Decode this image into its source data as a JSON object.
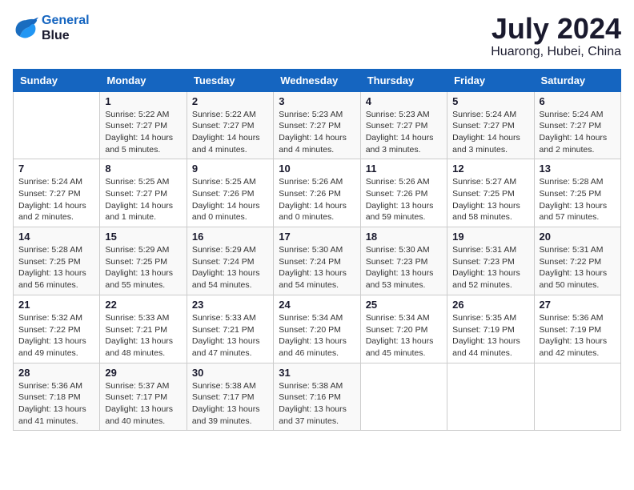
{
  "header": {
    "logo_line1": "General",
    "logo_line2": "Blue",
    "month_year": "July 2024",
    "location": "Huarong, Hubei, China"
  },
  "calendar": {
    "days_of_week": [
      "Sunday",
      "Monday",
      "Tuesday",
      "Wednesday",
      "Thursday",
      "Friday",
      "Saturday"
    ],
    "weeks": [
      [
        {
          "day": "",
          "info": ""
        },
        {
          "day": "1",
          "info": "Sunrise: 5:22 AM\nSunset: 7:27 PM\nDaylight: 14 hours\nand 5 minutes."
        },
        {
          "day": "2",
          "info": "Sunrise: 5:22 AM\nSunset: 7:27 PM\nDaylight: 14 hours\nand 4 minutes."
        },
        {
          "day": "3",
          "info": "Sunrise: 5:23 AM\nSunset: 7:27 PM\nDaylight: 14 hours\nand 4 minutes."
        },
        {
          "day": "4",
          "info": "Sunrise: 5:23 AM\nSunset: 7:27 PM\nDaylight: 14 hours\nand 3 minutes."
        },
        {
          "day": "5",
          "info": "Sunrise: 5:24 AM\nSunset: 7:27 PM\nDaylight: 14 hours\nand 3 minutes."
        },
        {
          "day": "6",
          "info": "Sunrise: 5:24 AM\nSunset: 7:27 PM\nDaylight: 14 hours\nand 2 minutes."
        }
      ],
      [
        {
          "day": "7",
          "info": "Sunrise: 5:24 AM\nSunset: 7:27 PM\nDaylight: 14 hours\nand 2 minutes."
        },
        {
          "day": "8",
          "info": "Sunrise: 5:25 AM\nSunset: 7:27 PM\nDaylight: 14 hours\nand 1 minute."
        },
        {
          "day": "9",
          "info": "Sunrise: 5:25 AM\nSunset: 7:26 PM\nDaylight: 14 hours\nand 0 minutes."
        },
        {
          "day": "10",
          "info": "Sunrise: 5:26 AM\nSunset: 7:26 PM\nDaylight: 14 hours\nand 0 minutes."
        },
        {
          "day": "11",
          "info": "Sunrise: 5:26 AM\nSunset: 7:26 PM\nDaylight: 13 hours\nand 59 minutes."
        },
        {
          "day": "12",
          "info": "Sunrise: 5:27 AM\nSunset: 7:25 PM\nDaylight: 13 hours\nand 58 minutes."
        },
        {
          "day": "13",
          "info": "Sunrise: 5:28 AM\nSunset: 7:25 PM\nDaylight: 13 hours\nand 57 minutes."
        }
      ],
      [
        {
          "day": "14",
          "info": "Sunrise: 5:28 AM\nSunset: 7:25 PM\nDaylight: 13 hours\nand 56 minutes."
        },
        {
          "day": "15",
          "info": "Sunrise: 5:29 AM\nSunset: 7:25 PM\nDaylight: 13 hours\nand 55 minutes."
        },
        {
          "day": "16",
          "info": "Sunrise: 5:29 AM\nSunset: 7:24 PM\nDaylight: 13 hours\nand 54 minutes."
        },
        {
          "day": "17",
          "info": "Sunrise: 5:30 AM\nSunset: 7:24 PM\nDaylight: 13 hours\nand 54 minutes."
        },
        {
          "day": "18",
          "info": "Sunrise: 5:30 AM\nSunset: 7:23 PM\nDaylight: 13 hours\nand 53 minutes."
        },
        {
          "day": "19",
          "info": "Sunrise: 5:31 AM\nSunset: 7:23 PM\nDaylight: 13 hours\nand 52 minutes."
        },
        {
          "day": "20",
          "info": "Sunrise: 5:31 AM\nSunset: 7:22 PM\nDaylight: 13 hours\nand 50 minutes."
        }
      ],
      [
        {
          "day": "21",
          "info": "Sunrise: 5:32 AM\nSunset: 7:22 PM\nDaylight: 13 hours\nand 49 minutes."
        },
        {
          "day": "22",
          "info": "Sunrise: 5:33 AM\nSunset: 7:21 PM\nDaylight: 13 hours\nand 48 minutes."
        },
        {
          "day": "23",
          "info": "Sunrise: 5:33 AM\nSunset: 7:21 PM\nDaylight: 13 hours\nand 47 minutes."
        },
        {
          "day": "24",
          "info": "Sunrise: 5:34 AM\nSunset: 7:20 PM\nDaylight: 13 hours\nand 46 minutes."
        },
        {
          "day": "25",
          "info": "Sunrise: 5:34 AM\nSunset: 7:20 PM\nDaylight: 13 hours\nand 45 minutes."
        },
        {
          "day": "26",
          "info": "Sunrise: 5:35 AM\nSunset: 7:19 PM\nDaylight: 13 hours\nand 44 minutes."
        },
        {
          "day": "27",
          "info": "Sunrise: 5:36 AM\nSunset: 7:19 PM\nDaylight: 13 hours\nand 42 minutes."
        }
      ],
      [
        {
          "day": "28",
          "info": "Sunrise: 5:36 AM\nSunset: 7:18 PM\nDaylight: 13 hours\nand 41 minutes."
        },
        {
          "day": "29",
          "info": "Sunrise: 5:37 AM\nSunset: 7:17 PM\nDaylight: 13 hours\nand 40 minutes."
        },
        {
          "day": "30",
          "info": "Sunrise: 5:38 AM\nSunset: 7:17 PM\nDaylight: 13 hours\nand 39 minutes."
        },
        {
          "day": "31",
          "info": "Sunrise: 5:38 AM\nSunset: 7:16 PM\nDaylight: 13 hours\nand 37 minutes."
        },
        {
          "day": "",
          "info": ""
        },
        {
          "day": "",
          "info": ""
        },
        {
          "day": "",
          "info": ""
        }
      ]
    ]
  }
}
